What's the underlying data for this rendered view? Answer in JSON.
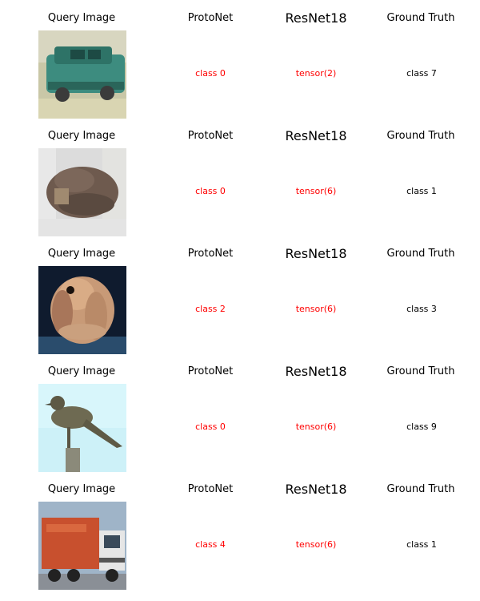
{
  "headers": {
    "query": "Query Image",
    "protonet": "ProtoNet",
    "resnet": "ResNet18",
    "truth": "Ground Truth"
  },
  "colors": {
    "wrong": "#ff0000",
    "truth": "#000000"
  },
  "rows": [
    {
      "image": "car-thumbnail",
      "protonet": "class 0",
      "resnet": "tensor(2)",
      "truth": "class 7"
    },
    {
      "image": "animal-thumbnail",
      "protonet": "class 0",
      "resnet": "tensor(6)",
      "truth": "class 1"
    },
    {
      "image": "dog-thumbnail",
      "protonet": "class 2",
      "resnet": "tensor(6)",
      "truth": "class 3"
    },
    {
      "image": "bird-thumbnail",
      "protonet": "class 0",
      "resnet": "tensor(6)",
      "truth": "class 9"
    },
    {
      "image": "truck-thumbnail",
      "protonet": "class 4",
      "resnet": "tensor(6)",
      "truth": "class 1"
    }
  ]
}
